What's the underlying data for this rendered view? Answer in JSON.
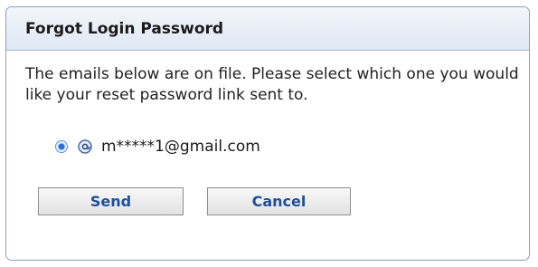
{
  "dialog": {
    "title": "Forgot Login Password",
    "message": "The emails below are on file. Please select which one you would like your reset password link sent to.",
    "email_options": [
      {
        "email": "m*****1@gmail.com",
        "selected": true,
        "icon": "email-at-icon"
      }
    ],
    "buttons": {
      "send": "Send",
      "cancel": "Cancel"
    }
  },
  "colors": {
    "header_gradient_top": "#f3f6fb",
    "header_gradient_bottom": "#dfe8f4",
    "border": "#8a9fbf",
    "button_text": "#1f4f9a",
    "radio_selected": "#2a6fd8"
  }
}
